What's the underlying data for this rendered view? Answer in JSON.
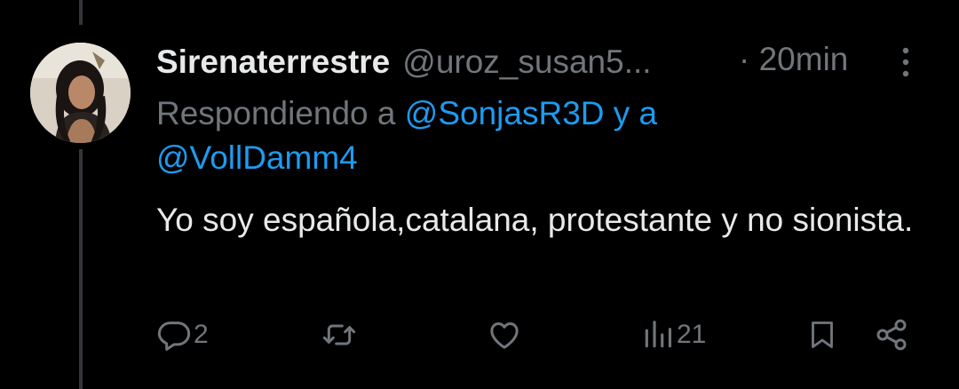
{
  "tweet": {
    "display_name": "Sirenaterrestre",
    "handle": "@uroz_susan5...",
    "time": "· 20min",
    "replying_prefix": "Respondiendo a ",
    "mention_1": "@SonjasR3D",
    "mention_joiner": " y a",
    "mention_2": "@VollDamm4",
    "text": "Yo soy española,catalana, protestante y no sionista."
  },
  "actions": {
    "reply_count": "2",
    "retweet_count": "",
    "like_count": "",
    "views_count": "21"
  },
  "icons": {
    "reply": "reply-bubble-icon",
    "retweet": "retweet-icon",
    "like": "heart-icon",
    "views": "views-bar-chart-icon",
    "bookmark": "bookmark-icon",
    "share": "share-icon",
    "more": "more-vertical-icon"
  },
  "colors": {
    "background": "#000000",
    "text_primary": "#e7e9ea",
    "text_secondary": "#71767b",
    "accent": "#1d9bf0",
    "thread_line": "#333639"
  }
}
